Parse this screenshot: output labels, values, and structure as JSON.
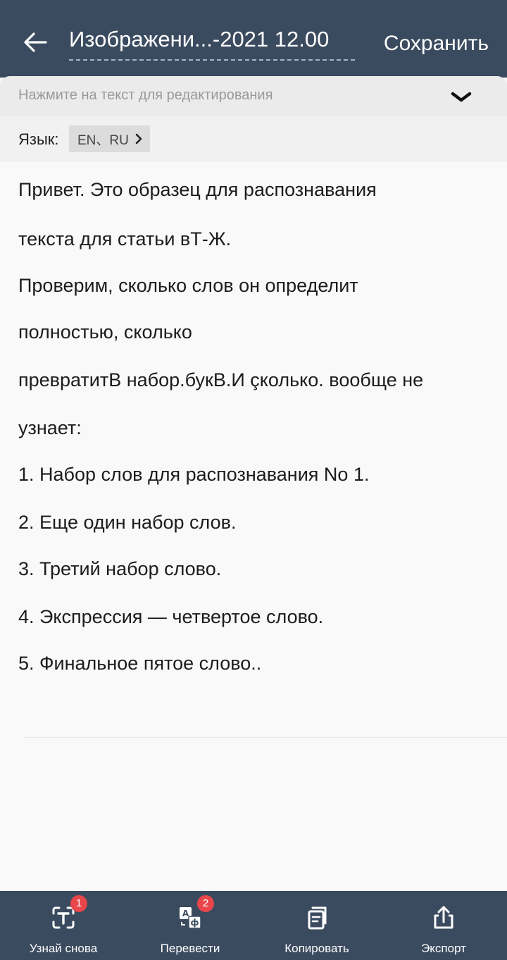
{
  "header": {
    "title": "Изображени...-2021 12.00",
    "save_label": "Сохранить"
  },
  "hint": {
    "text": "Нажмите на текст для редактирования"
  },
  "language": {
    "label": "Язык:",
    "value": "EN、RU"
  },
  "text_lines": [
    "Привет. Это образец для распознавания",
    "текста для статьи вТ-Ж.",
    "Проверим, сколько слов он определит",
    "полностью, сколько",
    "превратитВ набор.букВ.И çколько. вообще не",
    "узнает:",
    "1. Набор слов для распознавания No 1.",
    "2. Еще один набор слов.",
    "3. Третий набор слово.",
    "4. Экспрессия — четвертое слово.",
    "5. Финальное пятое слово.."
  ],
  "actions": [
    {
      "label": "Узнай снова",
      "icon": "recognize-icon",
      "badge": "1"
    },
    {
      "label": "Перевести",
      "icon": "translate-icon",
      "badge": "2"
    },
    {
      "label": "Копировать",
      "icon": "copy-icon"
    },
    {
      "label": "Экспорт",
      "icon": "export-icon"
    }
  ],
  "colors": {
    "header_bg": "#3b4b5f",
    "badge": "#e8464b"
  }
}
